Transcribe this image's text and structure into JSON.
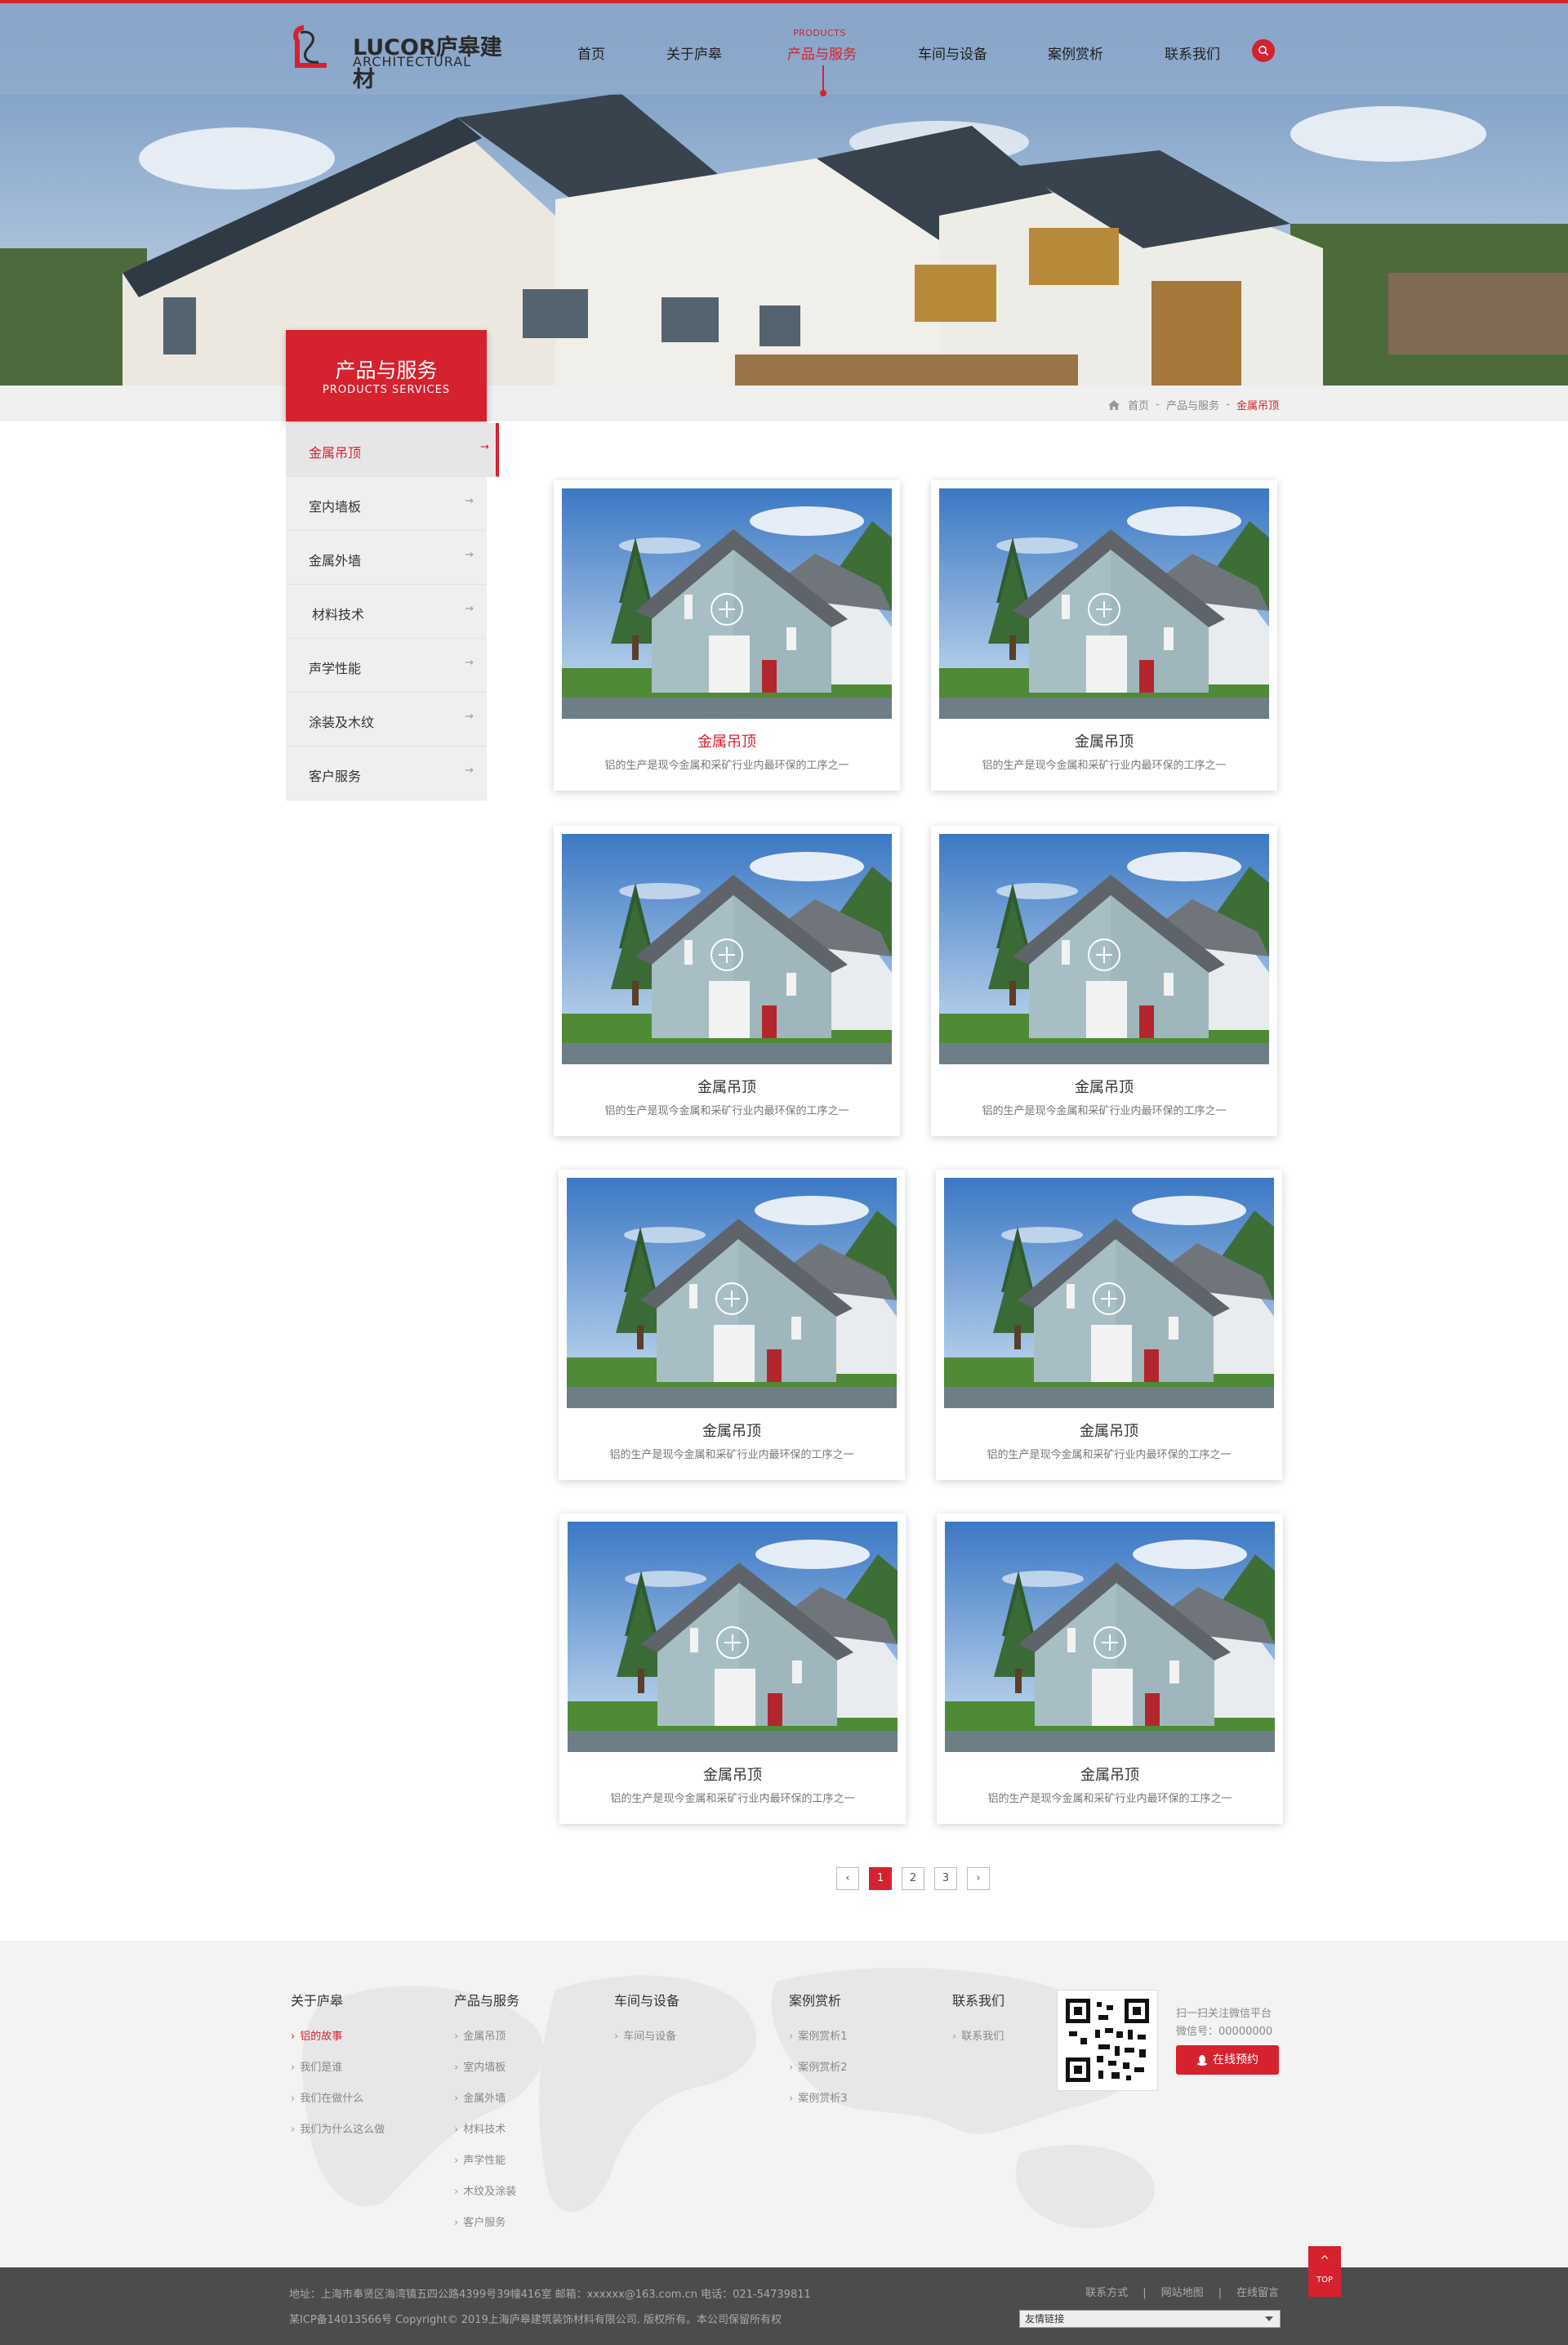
{
  "brand": {
    "logo_en": "LUCOR庐皋建材",
    "logo_sub": "ARCHITECTURAL",
    "accent_color": "#d6212e"
  },
  "nav": {
    "items": [
      {
        "label": "首页"
      },
      {
        "label": "关于庐皋"
      },
      {
        "label": "产品与服务",
        "small": "PRODUCTS"
      },
      {
        "label": "车间与设备"
      },
      {
        "label": "案例赏析"
      },
      {
        "label": "联系我们"
      }
    ],
    "active_index": 2,
    "search_icon": "search-icon"
  },
  "breadcrumb": {
    "home": "首页",
    "sep": "-",
    "level1": "产品与服务",
    "current": "金属吊顶"
  },
  "sidebar": {
    "title": "产品与服务",
    "subtitle": "PRODUCTS SERVICES",
    "arrow": "→",
    "items": [
      {
        "label": "金属吊顶"
      },
      {
        "label": "室内墙板"
      },
      {
        "label": "金属外墙"
      },
      {
        "label": "材料技术"
      },
      {
        "label": "声学性能"
      },
      {
        "label": "涂装及木纹"
      },
      {
        "label": "客户服务"
      }
    ],
    "active_index": 0
  },
  "products": [
    {
      "title": "金属吊顶",
      "desc": "铝的生产是现今金属和采矿行业内最环保的工序之一"
    },
    {
      "title": "金属吊顶",
      "desc": "铝的生产是现今金属和采矿行业内最环保的工序之一"
    },
    {
      "title": "金属吊顶",
      "desc": "铝的生产是现今金属和采矿行业内最环保的工序之一"
    },
    {
      "title": "金属吊顶",
      "desc": "铝的生产是现今金属和采矿行业内最环保的工序之一"
    },
    {
      "title": "金属吊顶",
      "desc": "铝的生产是现今金属和采矿行业内最环保的工序之一"
    },
    {
      "title": "金属吊顶",
      "desc": "铝的生产是现今金属和采矿行业内最环保的工序之一"
    },
    {
      "title": "金属吊顶",
      "desc": "铝的生产是现今金属和采矿行业内最环保的工序之一"
    },
    {
      "title": "金属吊顶",
      "desc": "铝的生产是现今金属和采矿行业内最环保的工序之一"
    }
  ],
  "pagination": {
    "prev": "‹",
    "pages": [
      "1",
      "2",
      "3"
    ],
    "next": "›",
    "current": "1"
  },
  "footer": {
    "columns": [
      {
        "heading": "关于庐皋",
        "links": [
          "铝的故事",
          "我们是谁",
          "我们在做什么",
          "我们为什么这么做"
        ]
      },
      {
        "heading": "产品与服务",
        "links": [
          "金属吊顶",
          "室内墙板",
          "金属外墙",
          "材料技术",
          "声学性能",
          "木纹及涂装",
          "客户服务"
        ]
      },
      {
        "heading": "车间与设备",
        "links": [
          "车间与设备"
        ]
      },
      {
        "heading": "案例赏析",
        "links": [
          "案例赏析1",
          "案例赏析2",
          "案例赏析3"
        ]
      },
      {
        "heading": "联系我们",
        "links": [
          "联系我们"
        ]
      }
    ],
    "wechat_line1": "扫一扫关注微信平台",
    "wechat_line2": "微信号：00000000",
    "online_button": "在线预约"
  },
  "bottom": {
    "address_line": "地址：上海市奉贤区海湾镇五四公路4399号39幢416室     邮箱：xxxxxx@163.com.cn     电话：021-54739811",
    "copyright_line": "某ICP备14013566号    Copyright© 2019上海庐皋建筑装饰材料有限公司. 版权所有。本公司保留所有权",
    "links": [
      "联系方式",
      "网站地图",
      "在线留言"
    ],
    "links_sep": "|",
    "friend_select": "友情链接"
  },
  "totop": {
    "arrow": "^",
    "label": "TOP"
  }
}
